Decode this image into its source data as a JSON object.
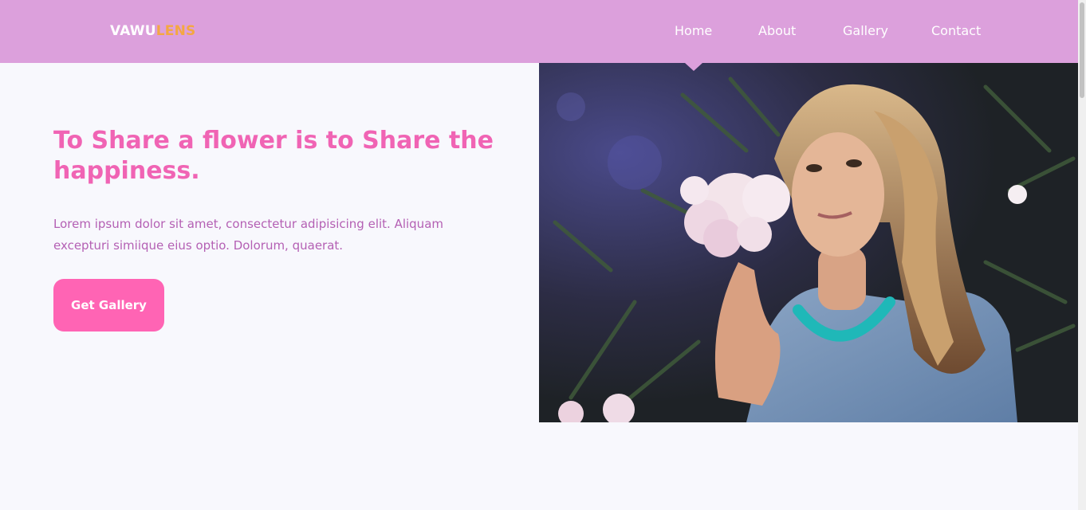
{
  "brand": {
    "part1": "VAWU",
    "part2": "LENS"
  },
  "nav": {
    "home": "Home",
    "about": "About",
    "gallery": "Gallery",
    "contact": "Contact"
  },
  "hero": {
    "title": "To Share a flower is to Share the happiness.",
    "text": "Lorem ipsum dolor sit amet, consectetur adipisicing elit. Aliquam excepturi simiique eius optio. Dolorum, quaerat.",
    "button": "Get Gallery"
  },
  "colors": {
    "nav_bg": "#dca0dc",
    "accent_pink": "#ff64b4",
    "heading": "#f064b4",
    "body_text": "#b460b4",
    "logo_accent": "#f4a742"
  }
}
